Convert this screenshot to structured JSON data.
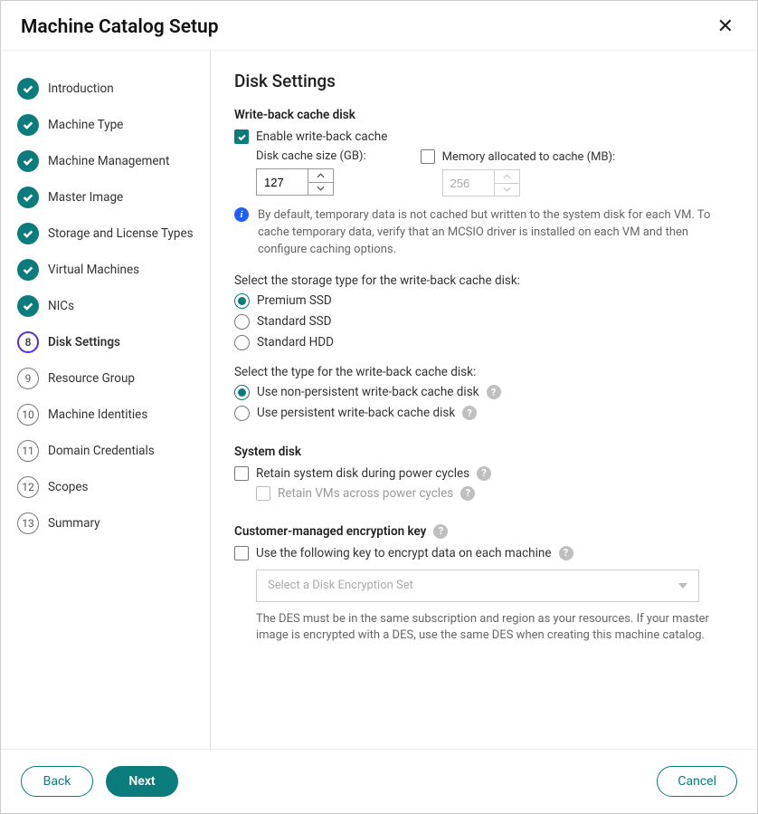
{
  "title": "Machine Catalog Setup",
  "steps": [
    {
      "label": "Introduction",
      "status": "done"
    },
    {
      "label": "Machine Type",
      "status": "done"
    },
    {
      "label": "Machine Management",
      "status": "done"
    },
    {
      "label": "Master Image",
      "status": "done"
    },
    {
      "label": "Storage and License Types",
      "status": "done"
    },
    {
      "label": "Virtual Machines",
      "status": "done"
    },
    {
      "label": "NICs",
      "status": "done"
    },
    {
      "label": "Disk Settings",
      "status": "current",
      "num": "8"
    },
    {
      "label": "Resource Group",
      "status": "pending",
      "num": "9"
    },
    {
      "label": "Machine Identities",
      "status": "pending",
      "num": "10"
    },
    {
      "label": "Domain Credentials",
      "status": "pending",
      "num": "11"
    },
    {
      "label": "Scopes",
      "status": "pending",
      "num": "12"
    },
    {
      "label": "Summary",
      "status": "pending",
      "num": "13"
    }
  ],
  "page": {
    "heading": "Disk Settings",
    "wbc": {
      "section": "Write-back cache disk",
      "enable": "Enable write-back cache",
      "disk_label": "Disk cache size (GB):",
      "disk_value": "127",
      "mem_label": "Memory allocated to cache (MB):",
      "mem_value": "256",
      "info": "By default, temporary data is not cached but written to the system disk for each VM. To cache temporary data, verify that an MCSIO driver is installed on each VM and then configure caching options.",
      "storage_prompt": "Select the storage type for the write-back cache disk:",
      "storage_opts": [
        "Premium SSD",
        "Standard SSD",
        "Standard HDD"
      ],
      "type_prompt": "Select the type for the write-back cache disk:",
      "type_opts": [
        "Use non-persistent write-back cache disk",
        "Use persistent write-back cache disk"
      ]
    },
    "system": {
      "section": "System disk",
      "retain": "Retain system disk during power cycles",
      "retain_vm": "Retain VMs across power cycles"
    },
    "cmek": {
      "section": "Customer-managed encryption key",
      "use": "Use the following key to encrypt data on each machine",
      "placeholder": "Select a Disk Encryption Set",
      "note": "The DES must be in the same subscription and region as your resources. If your master image is encrypted with a DES, use the same DES when creating this machine catalog."
    }
  },
  "footer": {
    "back": "Back",
    "next": "Next",
    "cancel": "Cancel"
  }
}
